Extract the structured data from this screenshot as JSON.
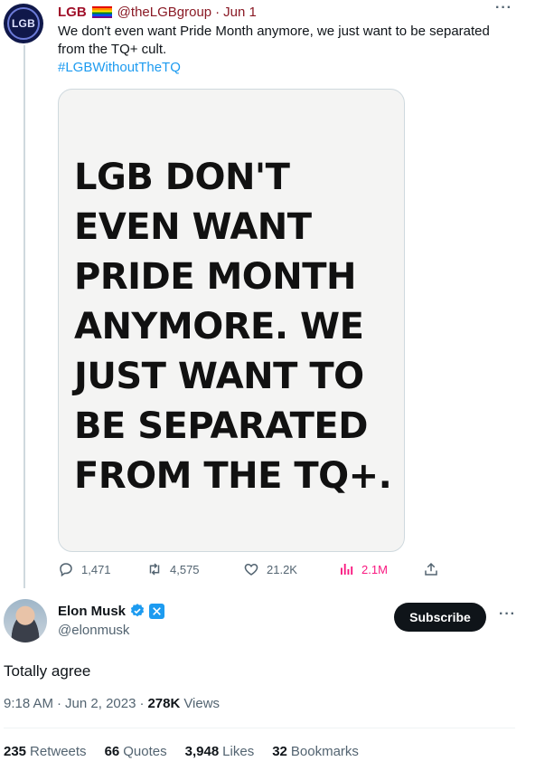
{
  "parent_tweet": {
    "avatar_text": "LGB",
    "display_name": "LGB",
    "handle": "@theLGBgroup",
    "separator": "·",
    "date": "Jun 1",
    "more": "···",
    "text": "We don't even want Pride Month anymore, we just want to be separated from the TQ+ cult.",
    "hashtag": "#LGBWithoutTheTQ",
    "image_text_lines": [
      "LGB DON'T",
      "EVEN WANT",
      "PRIDE MONTH",
      "ANYMORE. WE",
      "JUST WANT TO",
      "BE SEPARATED",
      "FROM THE TQ+."
    ],
    "actions": {
      "replies": "1,471",
      "retweets": "4,575",
      "likes": "21.2K",
      "views": "2.1M"
    }
  },
  "main_tweet": {
    "display_name": "Elon Musk",
    "handle": "@elonmusk",
    "subscribe_label": "Subscribe",
    "more": "···",
    "text": "Totally agree",
    "time": "9:18 AM",
    "date": "Jun 2, 2023",
    "views_count": "278K",
    "views_label": "Views",
    "stats": {
      "retweets_count": "235",
      "retweets_label": "Retweets",
      "quotes_count": "66",
      "quotes_label": "Quotes",
      "likes_count": "3,948",
      "likes_label": "Likes",
      "bookmarks_count": "32",
      "bookmarks_label": "Bookmarks"
    }
  },
  "colors": {
    "link": "#1d9bf0",
    "parent_name": "#a0102a",
    "views_accent": "#f91880",
    "subscribe_bg": "#0f1419"
  }
}
